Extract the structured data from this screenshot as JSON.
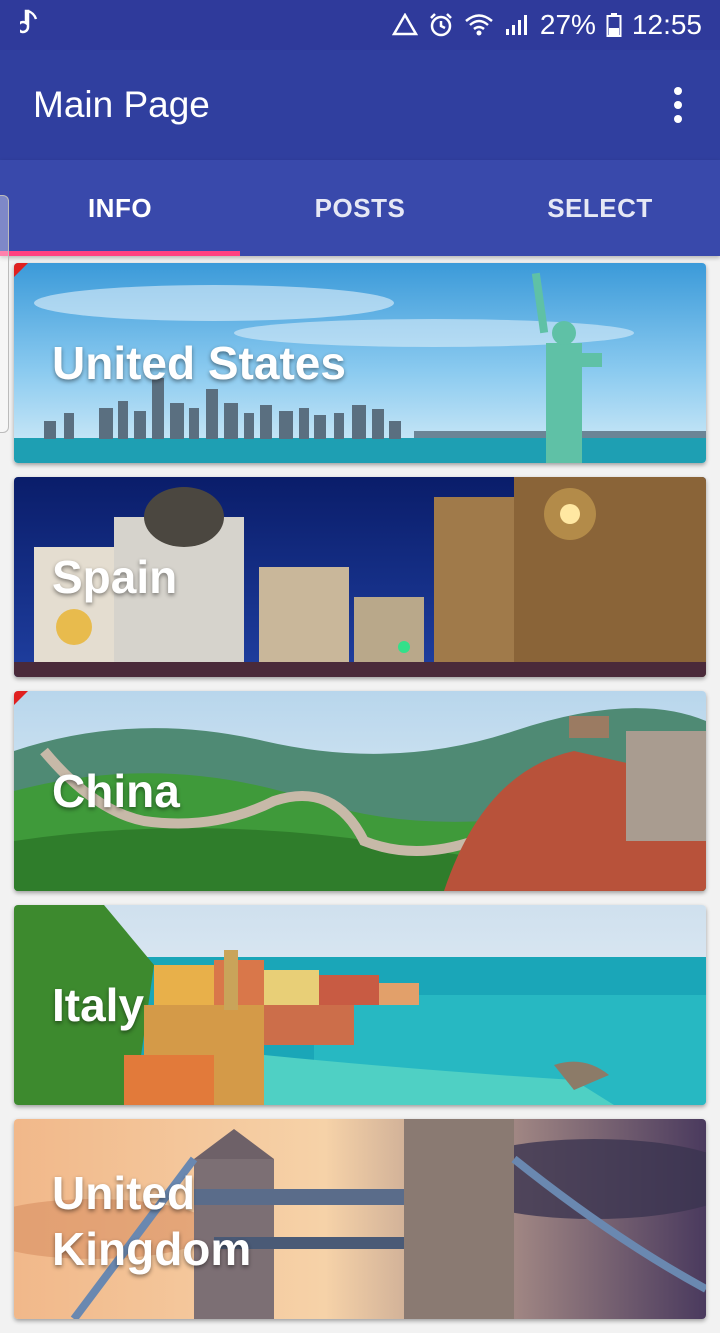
{
  "status_bar": {
    "music_icon": "music-note-icon",
    "battery_percent": "27%",
    "time": "12:55"
  },
  "app_bar": {
    "title": "Main Page",
    "menu_icon": "more-vert-icon"
  },
  "tabs": [
    {
      "label": "INFO",
      "active": true
    },
    {
      "label": "POSTS",
      "active": false
    },
    {
      "label": "SELECT",
      "active": false
    }
  ],
  "cards": [
    {
      "label": "United States"
    },
    {
      "label": "Spain"
    },
    {
      "label": "China"
    },
    {
      "label": "Italy"
    },
    {
      "label": "United Kingdom"
    }
  ],
  "colors": {
    "status_bar": "#2f3a9b",
    "app_bar": "#303f9f",
    "tab_bar": "#3949ab",
    "tab_indicator": "#ff4081"
  }
}
